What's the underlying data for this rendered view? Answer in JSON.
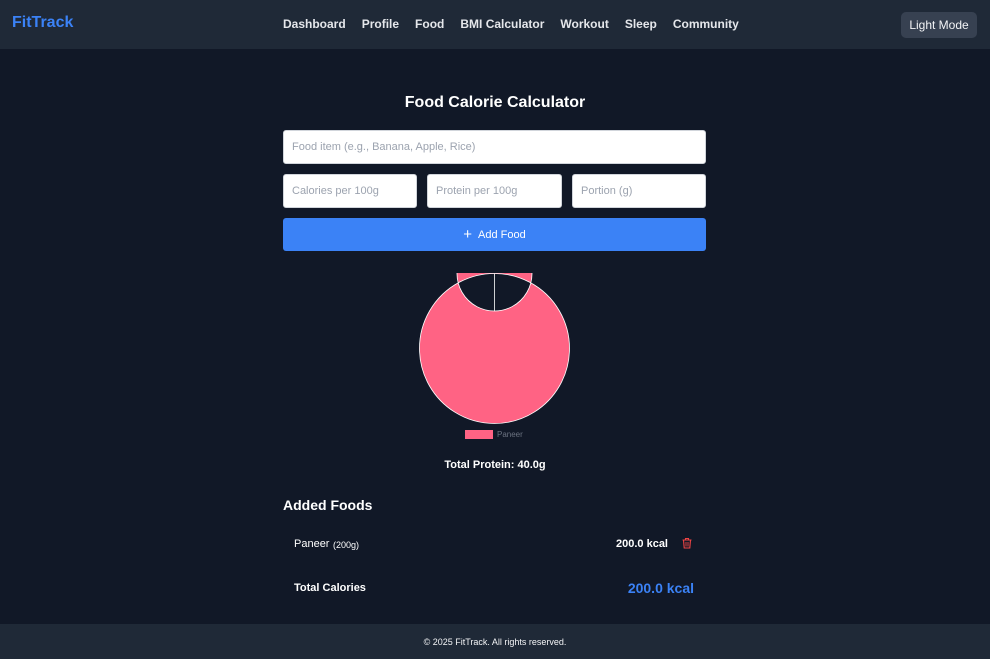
{
  "header": {
    "brand": "FitTrack",
    "nav": [
      "Dashboard",
      "Profile",
      "Food",
      "BMI Calculator",
      "Workout",
      "Sleep",
      "Community"
    ],
    "theme_toggle": "Light Mode"
  },
  "main": {
    "title": "Food Calorie Calculator",
    "inputs": {
      "food_placeholder": "Food item (e.g., Banana, Apple, Rice)",
      "calories_placeholder": "Calories per 100g",
      "protein_placeholder": "Protein per 100g",
      "portion_placeholder": "Portion (g)"
    },
    "add_button": "Add Food",
    "add_icon": "+",
    "total_protein": "Total Protein: 40.0g",
    "added_heading": "Added Foods",
    "foods": [
      {
        "name": "Paneer",
        "portion": "(200g)",
        "kcal": "200.0 kcal"
      }
    ],
    "total_label": "Total Calories",
    "total_value": "200.0 kcal"
  },
  "chart_data": {
    "type": "pie",
    "categories": [
      "Paneer"
    ],
    "values": [
      200
    ],
    "colors": [
      "#ff6384"
    ],
    "legend": "bottom",
    "donut": true
  },
  "colors": {
    "accent": "#3b82f6",
    "background": "#111827",
    "panel": "#1f2937",
    "delete": "#ef4444"
  },
  "footer": {
    "text": "© 2025 FitTrack. All rights reserved."
  }
}
